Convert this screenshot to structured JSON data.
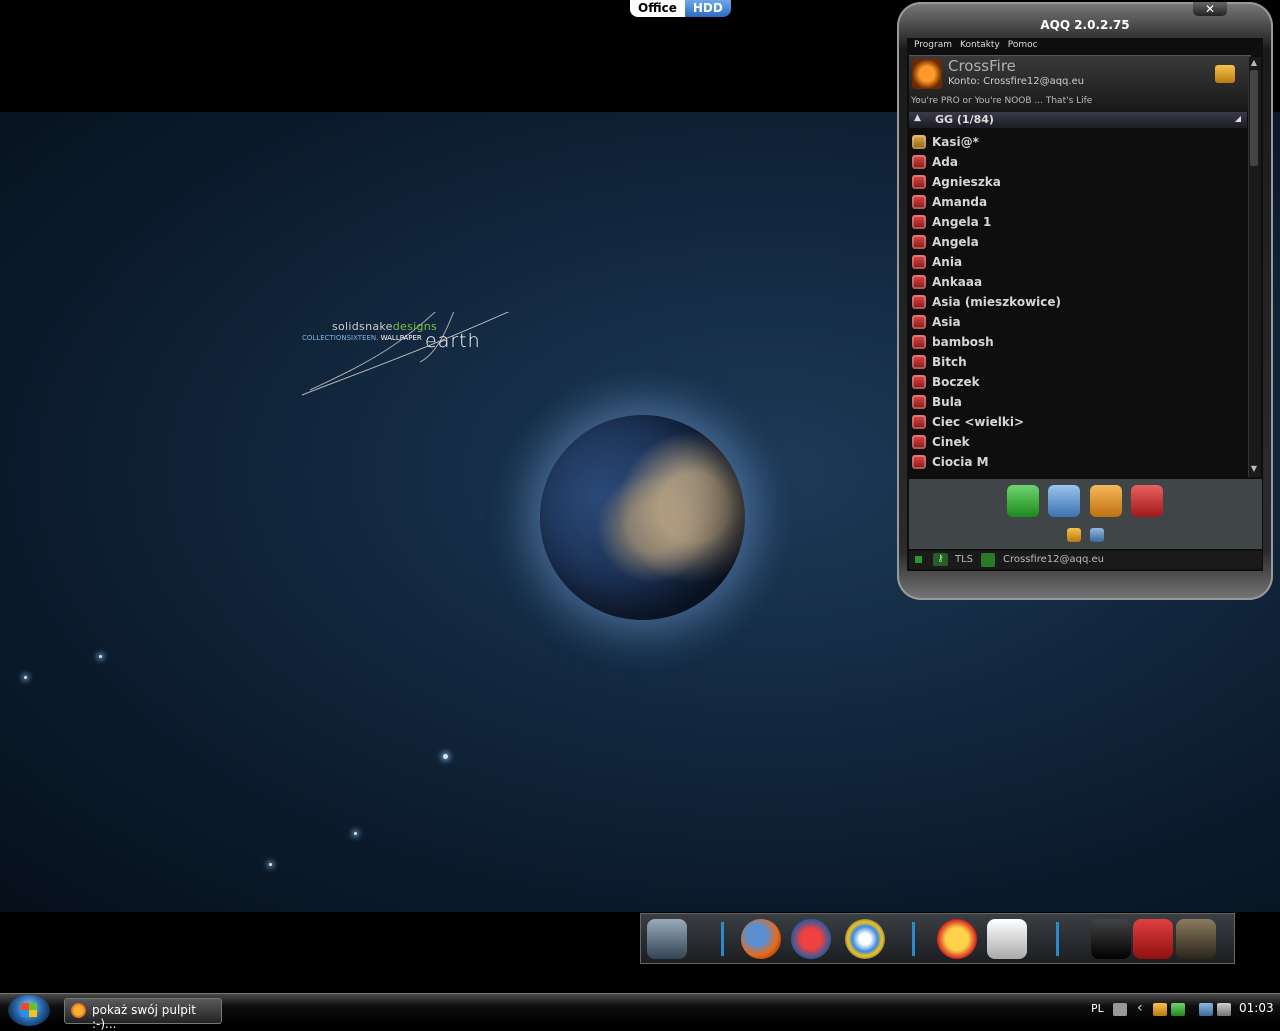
{
  "top_switcher": {
    "office": "Office",
    "hdd": "HDD"
  },
  "wallpaper": {
    "brand": "solidsnake",
    "brand_accent": "designs",
    "collection": "COLLECTIONSIXTEEN",
    "wallpaper_word": "WALLPAPER",
    "name": "earth"
  },
  "aqq": {
    "title": "AQQ 2.0.2.75",
    "close_label": "✕",
    "menu": [
      "Program",
      "Kontakty",
      "Pomoc"
    ],
    "profile": {
      "name": "CrossFire",
      "account": "Konto: Crossfire12@aqq.eu",
      "description": "You're PRO or You're NOOB ... That's Life"
    },
    "group": {
      "label": "GG (1/84)"
    },
    "contacts": [
      {
        "name": "Kasi@*",
        "status": "away"
      },
      {
        "name": "Ada",
        "status": "offline"
      },
      {
        "name": "Agnieszka",
        "status": "offline"
      },
      {
        "name": "Amanda",
        "status": "offline"
      },
      {
        "name": "Angela 1",
        "status": "offline"
      },
      {
        "name": "Angela",
        "status": "offline"
      },
      {
        "name": "Ania",
        "status": "offline"
      },
      {
        "name": "Ankaaa",
        "status": "offline"
      },
      {
        "name": "Asia (mieszkowice)",
        "status": "offline"
      },
      {
        "name": "Asia",
        "status": "offline"
      },
      {
        "name": "bambosh",
        "status": "offline"
      },
      {
        "name": "Bitch",
        "status": "offline"
      },
      {
        "name": "Boczek",
        "status": "offline"
      },
      {
        "name": "Bula",
        "status": "offline"
      },
      {
        "name": "Ciec <wielki>",
        "status": "offline"
      },
      {
        "name": "Cinek",
        "status": "offline"
      },
      {
        "name": "Ciocia M",
        "status": "offline"
      }
    ],
    "status_bar": {
      "security": "TLS",
      "account": "Crossfire12@aqq.eu"
    }
  },
  "taskbar": {
    "task_label": "pokaż swój pulpit :-)...",
    "language": "PL",
    "clock": "01:03"
  },
  "colors": {
    "accent_blue": "#2a8ad0",
    "status_offline": "#c03030",
    "status_away": "#c89030"
  }
}
